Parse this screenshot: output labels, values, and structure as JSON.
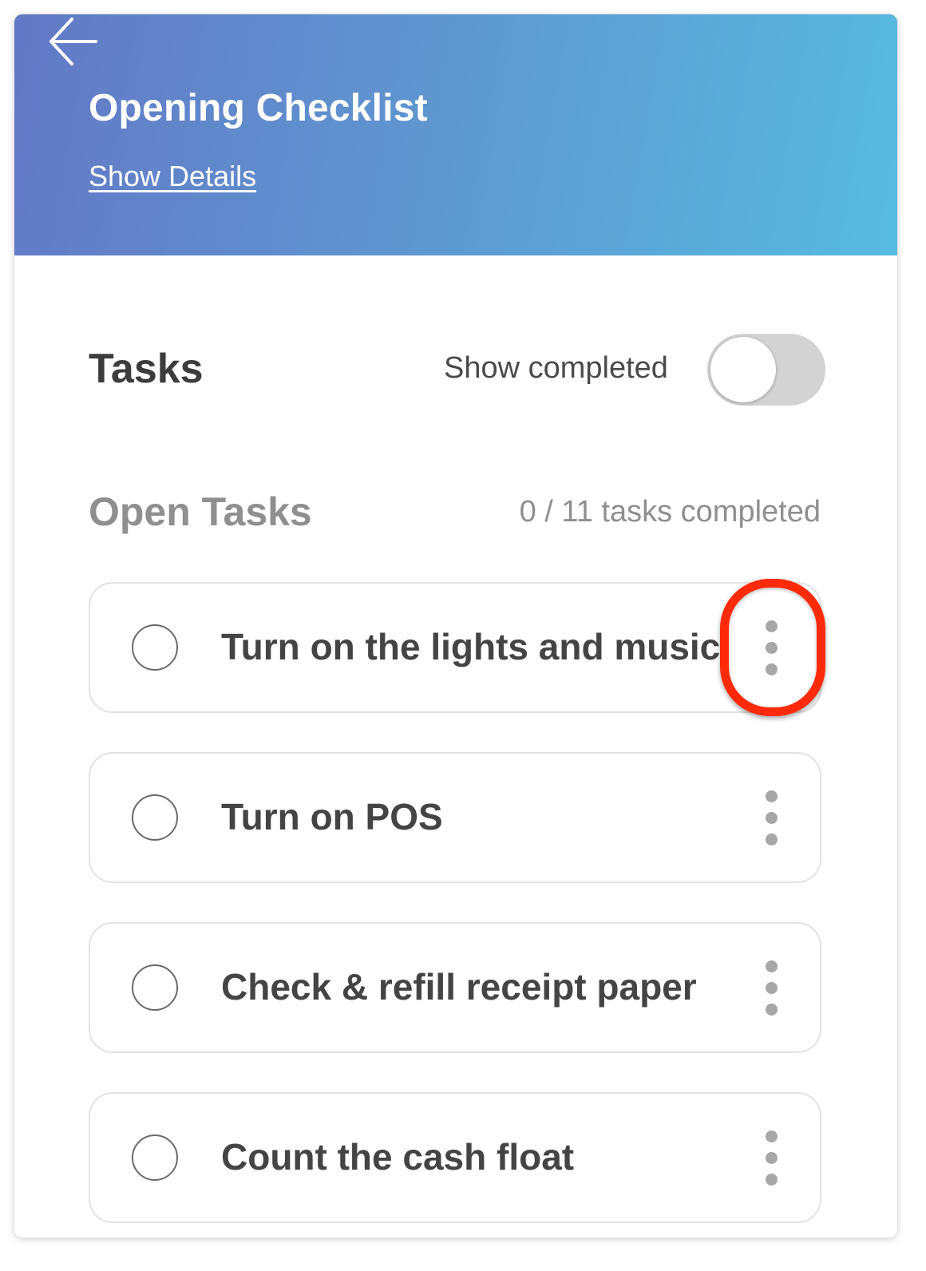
{
  "header": {
    "back_icon": "arrow-left-icon",
    "title": "Opening Checklist",
    "details_link": "Show Details"
  },
  "tasks_section": {
    "heading": "Tasks",
    "show_completed_label": "Show completed",
    "show_completed_on": false
  },
  "open_tasks": {
    "title": "Open Tasks",
    "progress": "0 / 11 tasks completed",
    "items": [
      {
        "label": "Turn on the lights and music"
      },
      {
        "label": "Turn on POS"
      },
      {
        "label": "Check & refill receipt paper"
      },
      {
        "label": "Count the cash float"
      }
    ]
  },
  "colors": {
    "header_gradient_start": "#6378c6",
    "header_gradient_end": "#57bbdf",
    "highlight_ring": "#ff2a0a",
    "toggle_off": "#d3d3d3"
  }
}
